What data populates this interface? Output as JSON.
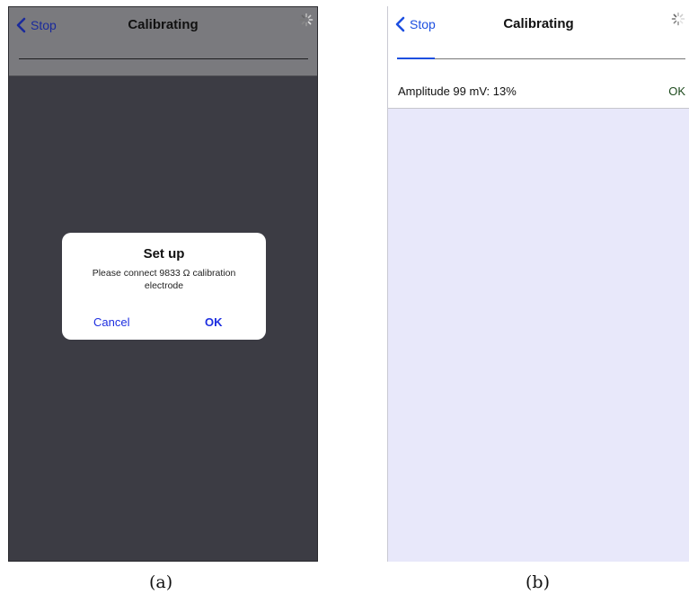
{
  "panel_a": {
    "nav": {
      "back_label": "Stop",
      "title": "Calibrating"
    },
    "dialog": {
      "title": "Set up",
      "message": "Please connect 9833 Ω calibration electrode",
      "cancel_label": "Cancel",
      "ok_label": "OK"
    },
    "caption": "(a)"
  },
  "panel_b": {
    "nav": {
      "back_label": "Stop",
      "title": "Calibrating"
    },
    "progress_fraction": 0.13,
    "row": {
      "label": "Amplitude 99 mV: 13%",
      "status": "OK"
    },
    "caption": "(b)"
  },
  "icons": [
    "chevron-left-icon",
    "activity-spinner-icon"
  ],
  "colors": {
    "link_blue": "#1d4fe0",
    "dimmed_background": "#3c3c44",
    "list_background": "#e8e8fa"
  }
}
